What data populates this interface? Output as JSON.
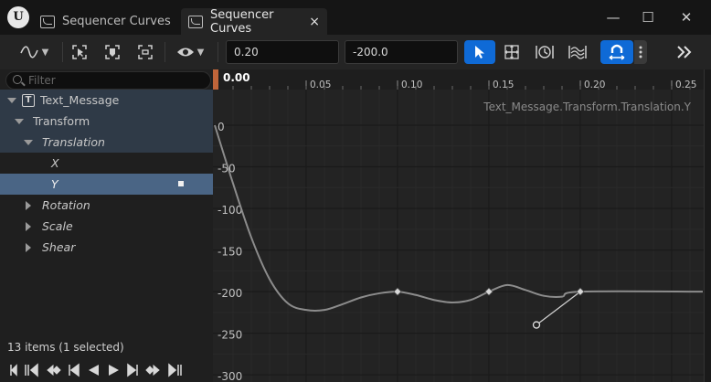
{
  "window": {
    "tabs": [
      {
        "label": "Sequencer Curves",
        "active": false
      },
      {
        "label": "Sequencer Curves",
        "active": true
      }
    ],
    "close_glyph": "×",
    "minimize_glyph": "—",
    "maximize_glyph": "☐",
    "close_window_glyph": "✕"
  },
  "toolbar": {
    "time_value": "0.20",
    "key_value": "-200.0",
    "icons": [
      "curve-mode-icon",
      "frame-selected-icon",
      "frame-all-icon",
      "fit-view-icon",
      "visibility-icon",
      "select-tool-icon",
      "transform-tool-icon",
      "retime-tool-icon",
      "multi-select-tool-icon",
      "snap-icon",
      "more-icon",
      "expand-icon"
    ]
  },
  "sidebar": {
    "filter_placeholder": "Filter",
    "items": [
      {
        "label": "Text_Message",
        "indent": 0,
        "expanded": true,
        "italic": false
      },
      {
        "label": "Transform",
        "indent": 1,
        "expanded": true,
        "italic": false
      },
      {
        "label": "Translation",
        "indent": 2,
        "expanded": true,
        "italic": true
      },
      {
        "label": "X",
        "indent": 3,
        "italic": true
      },
      {
        "label": "Y",
        "indent": 3,
        "italic": true,
        "selected": true
      },
      {
        "label": "Rotation",
        "indent": 2,
        "expanded": false,
        "italic": true
      },
      {
        "label": "Scale",
        "indent": 2,
        "expanded": false,
        "italic": true
      },
      {
        "label": "Shear",
        "indent": 2,
        "expanded": false,
        "italic": true
      }
    ],
    "status": "13 items (1 selected)"
  },
  "colors": {
    "accent_blue": "#0f6ad6",
    "selected_row": "#4a6585",
    "playhead": "#c0653a",
    "curve": "#8c8c8c"
  },
  "curve_editor": {
    "current_time": "0.00",
    "curve_name": "Text_Message.Transform.Translation.Y",
    "time_ticks": [
      "0.05",
      "0.10",
      "0.15",
      "0.20",
      "0.25"
    ],
    "value_ticks": [
      "0",
      "-50",
      "-100",
      "-150",
      "-200",
      "-250",
      "-300"
    ]
  },
  "chart_data": {
    "type": "line",
    "title": "Text_Message.Transform.Translation.Y",
    "xlabel": "",
    "ylabel": "",
    "xlim": [
      0.0,
      0.267
    ],
    "ylim": [
      -300,
      10
    ],
    "x_ticks": [
      0.05,
      0.1,
      0.15,
      0.2,
      0.25
    ],
    "y_ticks": [
      0,
      -50,
      -100,
      -150,
      -200,
      -250,
      -300
    ],
    "series": [
      {
        "points": [
          [
            0.0,
            0
          ],
          [
            0.01,
            -70
          ],
          [
            0.02,
            -135
          ],
          [
            0.03,
            -185
          ],
          [
            0.04,
            -214
          ],
          [
            0.05,
            -222
          ],
          [
            0.06,
            -222
          ],
          [
            0.07,
            -215
          ],
          [
            0.08,
            -207
          ],
          [
            0.09,
            -202
          ],
          [
            0.1,
            -200
          ],
          [
            0.11,
            -204
          ],
          [
            0.12,
            -210
          ],
          [
            0.13,
            -213
          ],
          [
            0.14,
            -210
          ],
          [
            0.15,
            -200
          ],
          [
            0.16,
            -192
          ],
          [
            0.17,
            -198
          ],
          [
            0.18,
            -205
          ],
          [
            0.19,
            -206
          ],
          [
            0.2,
            -200
          ],
          [
            0.267,
            -200
          ]
        ]
      }
    ],
    "keyframes": [
      {
        "time": 0.1,
        "value": -200
      },
      {
        "time": 0.15,
        "value": -200
      },
      {
        "time": 0.2,
        "value": -200
      }
    ],
    "tangent_handle": {
      "from": [
        0.2,
        -200
      ],
      "to": [
        0.176,
        -240
      ]
    },
    "grid": true
  }
}
